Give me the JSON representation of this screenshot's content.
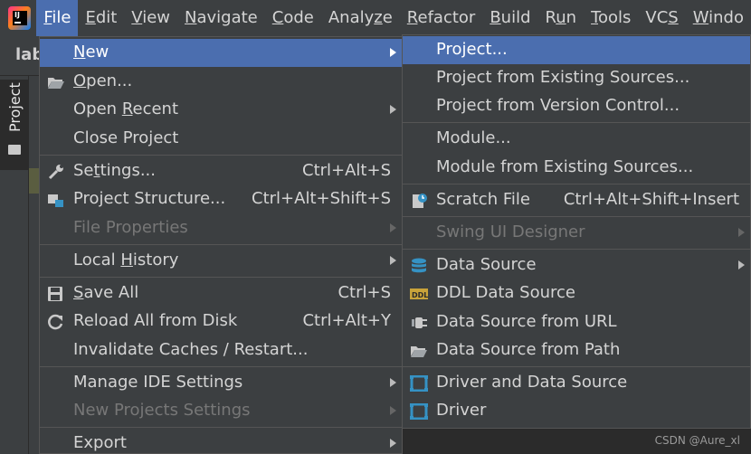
{
  "menubar": {
    "items": [
      {
        "pre": "",
        "u": "F",
        "post": "ile"
      },
      {
        "pre": "",
        "u": "E",
        "post": "dit"
      },
      {
        "pre": "",
        "u": "V",
        "post": "iew"
      },
      {
        "pre": "",
        "u": "N",
        "post": "avigate"
      },
      {
        "pre": "",
        "u": "C",
        "post": "ode"
      },
      {
        "pre": "Analy",
        "u": "z",
        "post": "e"
      },
      {
        "pre": "",
        "u": "R",
        "post": "efactor"
      },
      {
        "pre": "",
        "u": "B",
        "post": "uild"
      },
      {
        "pre": "R",
        "u": "u",
        "post": "n"
      },
      {
        "pre": "",
        "u": "T",
        "post": "ools"
      },
      {
        "pre": "VC",
        "u": "S",
        "post": ""
      },
      {
        "pre": "",
        "u": "W",
        "post": "indo"
      }
    ]
  },
  "app": {
    "logo_text": "IJ",
    "breadcrumb": "lab",
    "side_tab": "Project"
  },
  "file_menu": {
    "new": {
      "pre": "",
      "u": "N",
      "post": "ew"
    },
    "open": {
      "pre": "",
      "u": "O",
      "post": "pen..."
    },
    "open_recent": {
      "pre": "Open ",
      "u": "R",
      "post": "ecent"
    },
    "close_project": {
      "pre": "Close Project",
      "u": "",
      "post": ""
    },
    "settings": {
      "pre": "Se",
      "u": "t",
      "post": "tings...",
      "shortcut": "Ctrl+Alt+S"
    },
    "project_structure": {
      "pre": "Project Structure...",
      "u": "",
      "post": "",
      "shortcut": "Ctrl+Alt+Shift+S"
    },
    "file_properties": {
      "pre": "File Properties",
      "u": "",
      "post": ""
    },
    "local_history": {
      "pre": "Local ",
      "u": "H",
      "post": "istory"
    },
    "save_all": {
      "pre": "",
      "u": "S",
      "post": "ave All",
      "shortcut": "Ctrl+S"
    },
    "reload": {
      "pre": "Reload All from Disk",
      "u": "",
      "post": "",
      "shortcut": "Ctrl+Alt+Y"
    },
    "invalidate": {
      "pre": "Invalidate Caches / Restart...",
      "u": "",
      "post": ""
    },
    "manage_ide": {
      "pre": "Manage IDE Settings",
      "u": "",
      "post": ""
    },
    "new_projects_settings": {
      "pre": "New Projects Settings",
      "u": "",
      "post": ""
    },
    "export": {
      "pre": "Export",
      "u": "",
      "post": ""
    }
  },
  "new_menu": {
    "project": "Project...",
    "project_existing": "Project from Existing Sources...",
    "project_vcs": "Project from Version Control...",
    "module": "Module...",
    "module_existing": "Module from Existing Sources...",
    "scratch": {
      "label": "Scratch File",
      "shortcut": "Ctrl+Alt+Shift+Insert"
    },
    "swing": "Swing UI Designer",
    "data_source": "Data Source",
    "ddl": "DDL Data Source",
    "ds_url": "Data Source from URL",
    "ds_path": "Data Source from Path",
    "driver_ds": "Driver and Data Source",
    "driver": "Driver"
  },
  "watermark": "CSDN @Aure_xl",
  "colors": {
    "highlight": "#4b6eaf",
    "menu_bg": "#3c3f41",
    "editor_bg": "#2b2b2b",
    "db_icon": "#3592c4"
  }
}
